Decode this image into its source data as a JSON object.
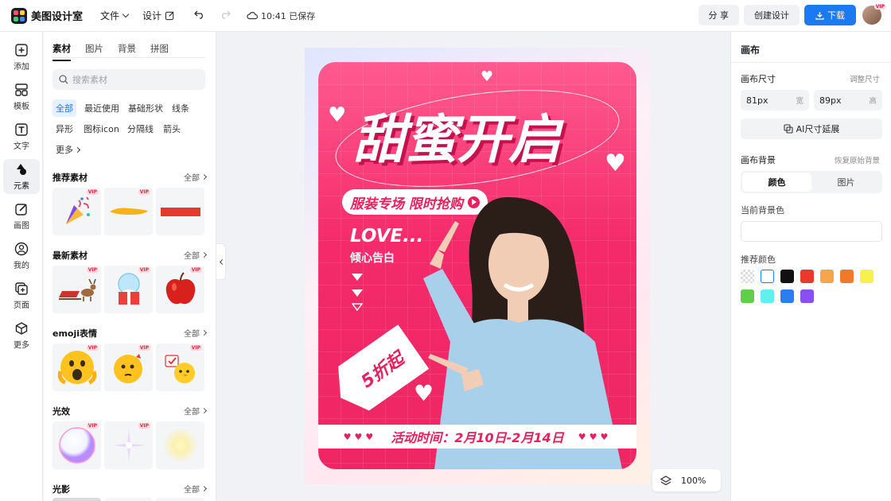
{
  "app": {
    "name": "美图设计室",
    "menu_file": "文件",
    "menu_design": "设计",
    "saved_status": "10:41 已保存",
    "share": "分 享",
    "create_design": "创建设计",
    "download": "下载",
    "avatar_badge": "VIP"
  },
  "leftnav": [
    {
      "label": "添加",
      "icon": "plus-square-icon"
    },
    {
      "label": "模板",
      "icon": "template-icon"
    },
    {
      "label": "文字",
      "icon": "text-icon"
    },
    {
      "label": "元素",
      "icon": "shapes-icon"
    },
    {
      "label": "画图",
      "icon": "draw-icon"
    },
    {
      "label": "我的",
      "icon": "user-icon"
    },
    {
      "label": "页面",
      "icon": "page-add-icon"
    },
    {
      "label": "更多",
      "icon": "cube-icon"
    }
  ],
  "panel": {
    "tabs": [
      "素材",
      "图片",
      "背景",
      "拼图"
    ],
    "search_placeholder": "搜索素材",
    "chips": [
      "全部",
      "最近使用",
      "基础形状",
      "线条",
      "异形",
      "图标icon",
      "分隔线",
      "箭头",
      "更多"
    ],
    "all_label": "全部",
    "vip": "VIP",
    "sections": [
      {
        "title": "推荐素材"
      },
      {
        "title": "最新素材"
      },
      {
        "title": "emoji表情"
      },
      {
        "title": "光效"
      },
      {
        "title": "光影"
      }
    ]
  },
  "poster": {
    "title": "甜蜜开启",
    "subtitle": "服装专场 限时抢购",
    "love": "LOVE...",
    "love_sub": "倾心告白",
    "tag": "5折起",
    "date_text": "活动时间：2月10日-2月14日",
    "hearts": "♥♥♥"
  },
  "zoom": "100%",
  "right": {
    "title": "画布",
    "canvas_size": "画布尺寸",
    "resize": "调整尺寸",
    "width_value": "81px",
    "width_unit": "宽",
    "height_value": "89px",
    "height_unit": "高",
    "ai_expand": "AI尺寸延展",
    "canvas_bg": "画布背景",
    "restore_bg": "恢复原始背景",
    "seg_color": "颜色",
    "seg_image": "图片",
    "current_bg": "当前背景色",
    "recommended": "推荐颜色",
    "swatches": [
      "transparent",
      "#ffffff",
      "#111111",
      "#e8392b",
      "#f5a64a",
      "#f07a2a",
      "#f7f24a",
      "#5fcf48",
      "#5ff0ef",
      "#2a7ef0",
      "#8a4ff0"
    ]
  }
}
